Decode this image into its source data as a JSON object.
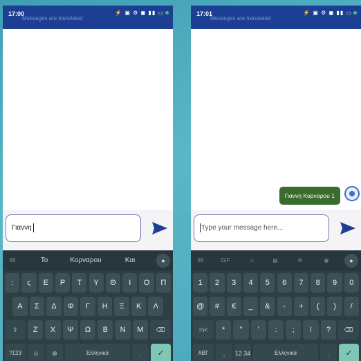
{
  "screens": [
    {
      "status": {
        "time": "17:00",
        "icons": "⚡ ▣ ⚙ ◼ ▮▮ ▭"
      },
      "banner": "Messages are translated",
      "input": {
        "value": "Γιαννη",
        "placeholder": ""
      },
      "toolbar": {
        "grid": "88",
        "suggestions": [
          "Το",
          "Κορναρου",
          "Και"
        ]
      },
      "rows": [
        [
          ":",
          "ς",
          "Ε",
          "Ρ",
          "Τ",
          "Υ",
          "Θ",
          "Ι",
          "Ο",
          "Π"
        ],
        [
          "Α",
          "Σ",
          "Δ",
          "Φ",
          "Γ",
          "Η",
          "Ξ",
          "Κ",
          "Λ"
        ],
        [
          "⇧",
          "Ζ",
          "Χ",
          "Ψ",
          "Ω",
          "Β",
          "Ν",
          "Μ",
          "⌫"
        ],
        [
          "?123",
          "☺",
          "⊕",
          "Ελληνικά",
          ".",
          "✓"
        ]
      ]
    },
    {
      "status": {
        "time": "17:01",
        "icons": "⚡ ▣ ⚙ ◼ ▮▮ ▭"
      },
      "banner": "Messages are translated",
      "bubble": "Γιαννη Κορναρου 1",
      "input": {
        "value": "",
        "placeholder": "Type your message here..."
      },
      "toolbar": {
        "grid": "88",
        "gif": "GIF",
        "tools": [
          "☺",
          "▤",
          "⚙",
          "◉"
        ]
      },
      "rows": [
        [
          "1",
          "2",
          "3",
          "4",
          "5",
          "6",
          "7",
          "8",
          "9",
          "0"
        ],
        [
          "@",
          "#",
          "€",
          "_",
          "&",
          "-",
          "+",
          "(",
          ")",
          "/"
        ],
        [
          "=\\<",
          "*",
          "\"",
          "'",
          ":",
          ";",
          "!",
          "?",
          "⌫"
        ],
        [
          "ΑΒΓ",
          ",",
          "12 34",
          "Ελληνικά",
          ".",
          "✓"
        ]
      ]
    }
  ],
  "colors": {
    "header": "#1c3f94",
    "bubble": "#3a6a2e",
    "keyboard": "#2d3e45",
    "accent": "#1c3f94"
  }
}
